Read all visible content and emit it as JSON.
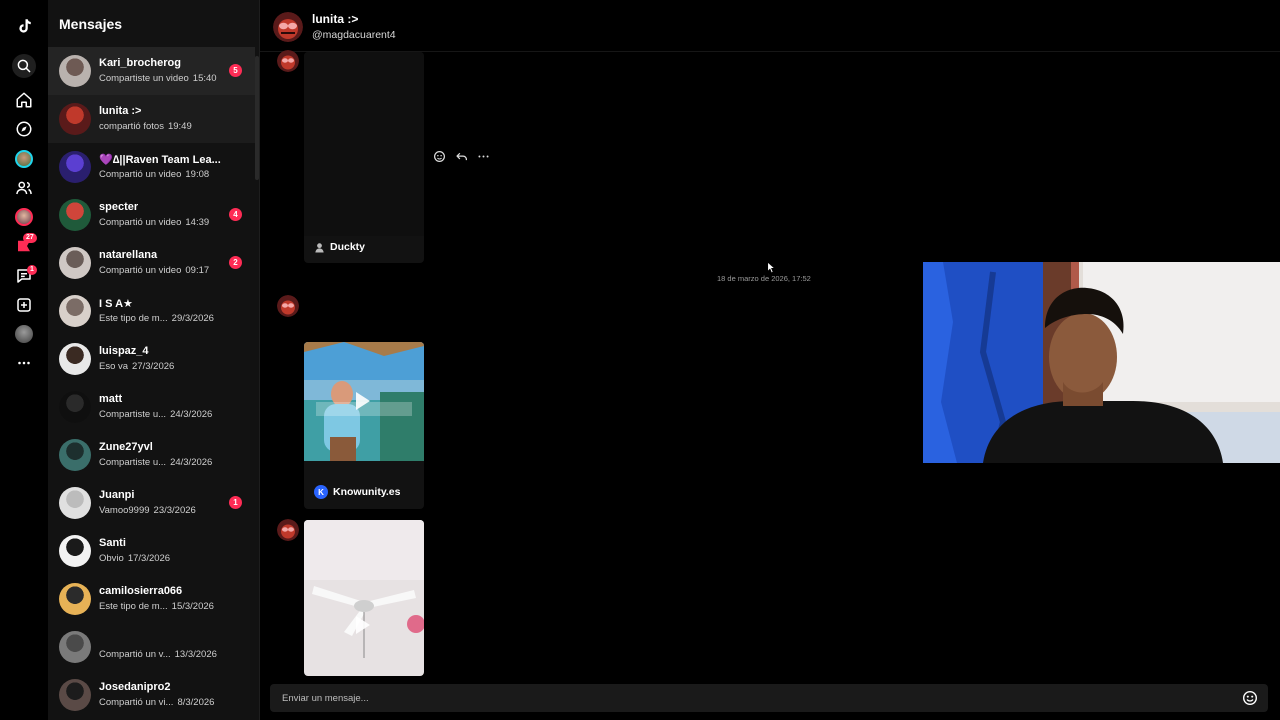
{
  "sidebar_title": "Mensajes",
  "rail": {
    "activity_badge": "27",
    "inbox_badge": "1"
  },
  "conversations": [
    {
      "name": "Kari_brocherog",
      "preview": "Compartiste un video",
      "time": "15:40",
      "badge": "5"
    },
    {
      "name": "lunita :>",
      "preview": "compartió fotos",
      "time": "19:49",
      "badge": ""
    },
    {
      "name": "💜∆||Raven Team Lea...",
      "preview": "Compartió un video",
      "time": "19:08",
      "badge": ""
    },
    {
      "name": "specter",
      "preview": "Compartió un video",
      "time": "14:39",
      "badge": "4"
    },
    {
      "name": "natarellana",
      "preview": "Compartió un video",
      "time": "09:17",
      "badge": "2"
    },
    {
      "name": "I S A★",
      "preview": "Este tipo de m...",
      "time": "29/3/2026",
      "badge": ""
    },
    {
      "name": "luispaz_4",
      "preview": "Eso va",
      "time": "27/3/2026",
      "badge": ""
    },
    {
      "name": "matt",
      "preview": "Compartiste u...",
      "time": "24/3/2026",
      "badge": ""
    },
    {
      "name": "Zune27yvl",
      "preview": "Compartiste u...",
      "time": "24/3/2026",
      "badge": ""
    },
    {
      "name": "Juanpi",
      "preview": "Vamoo9999",
      "time": "23/3/2026",
      "badge": "1"
    },
    {
      "name": "Santi",
      "preview": "Obvio",
      "time": "17/3/2026",
      "badge": ""
    },
    {
      "name": "camilosierra066",
      "preview": "Este tipo de m...",
      "time": "15/3/2026",
      "badge": ""
    },
    {
      "name": "",
      "preview": "Compartió un v...",
      "time": "13/3/2026",
      "badge": ""
    },
    {
      "name": "Josedanipro2",
      "preview": "Compartió un vi...",
      "time": "8/3/2026",
      "badge": ""
    }
  ],
  "chat": {
    "name": "lunita :>",
    "handle": "@magdacuarent4",
    "messages": [
      {
        "type": "video",
        "author": "Duckty"
      },
      {
        "type": "video",
        "author": "Knowunity.es"
      },
      {
        "type": "video",
        "author": ""
      }
    ],
    "timestamp": "18 de marzo de 2026, 17:52",
    "compose_placeholder": "Enviar un mensaje..."
  },
  "colors": {
    "accent": "#fe2c55",
    "background": "#000000",
    "panel": "#121212"
  }
}
